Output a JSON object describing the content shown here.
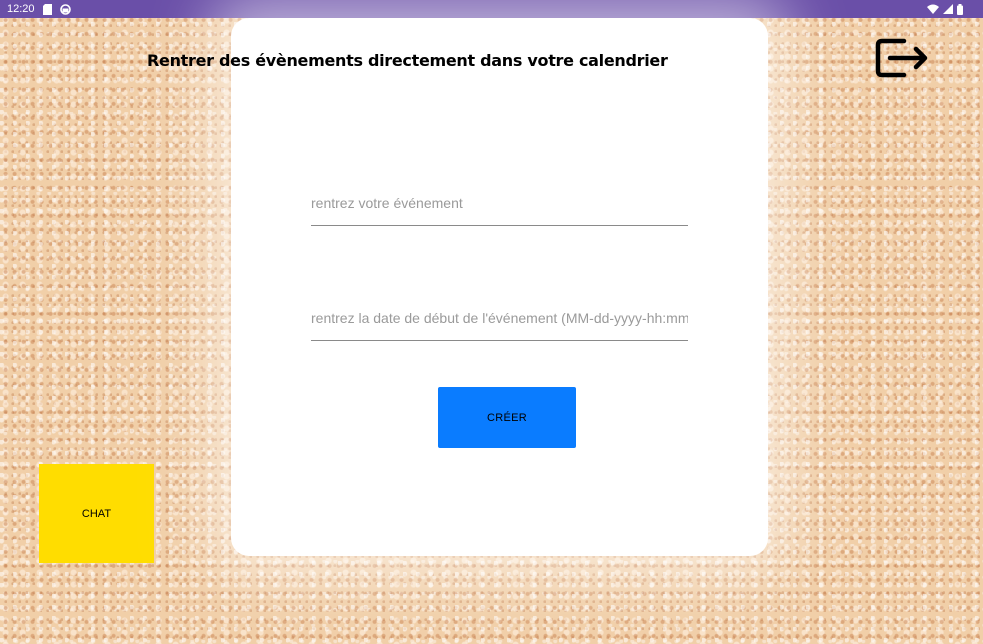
{
  "status_bar": {
    "time": "12:20",
    "icons": [
      "sd-card-icon",
      "sync-icon",
      "wifi-icon",
      "signal-icon",
      "battery-icon"
    ],
    "color": "#6a4fa8"
  },
  "header": {
    "title": "Rentrer des évènements directement dans votre calendrier"
  },
  "form": {
    "event_placeholder": "rentrez votre événement",
    "event_value": "",
    "date_placeholder": "rentrez la date de début de l'événement (MM-dd-yyyy-hh:mm)",
    "date_value": "",
    "create_label": "CRÉER",
    "create_color": "#0a7cff"
  },
  "chat_button": {
    "label": "CHAT",
    "color": "#ffdd00"
  },
  "exit_button": {
    "icon": "exit-icon"
  }
}
